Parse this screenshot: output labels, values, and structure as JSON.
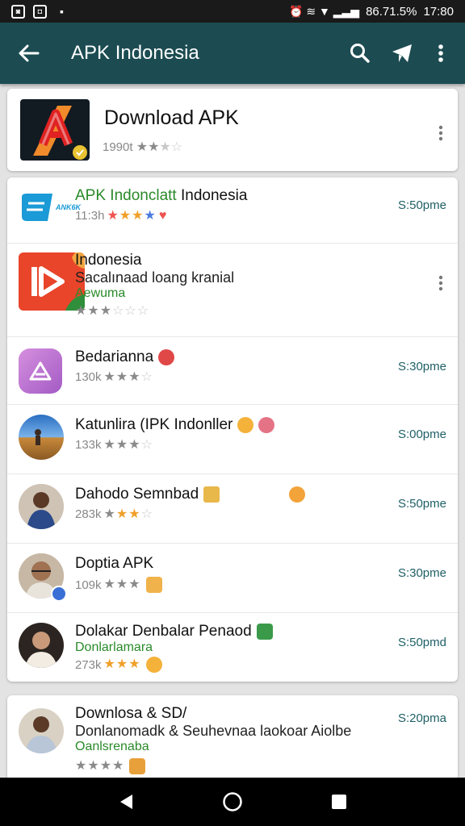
{
  "status_bar": {
    "notifications": [
      "◙",
      "◘",
      "▪"
    ],
    "indicators": "⏰ ≋ ▼ ▂▃▅",
    "battery": "86.71.5%",
    "time": "17:80"
  },
  "toolbar": {
    "title": "APK Indonesia",
    "icons": [
      "back-arrow-icon",
      "search-icon",
      "send-icon",
      "more-vert-icon"
    ]
  },
  "header_app": {
    "title": "Download APK",
    "count": "1990t",
    "rating": 2.5
  },
  "list": [
    {
      "title_green": "APK Indonclatt",
      "title_dark": "Indonesia",
      "count": "11:3h",
      "time": "S:50pme",
      "icon": "apk-logo-icon",
      "icon_text": "ANK6K"
    },
    {
      "title": "Indonesia",
      "subtitle": "Sacalınaad loang kranial",
      "green": "Aewuma",
      "icon": "video-play-icon"
    },
    {
      "title": "Bedarianna",
      "count": "130k",
      "time": "S:30pme",
      "icon": "purple-app-icon"
    },
    {
      "title": "Katunlira (IPK Indonller",
      "count": "133k",
      "time": "S:00pme",
      "icon": "landscape-avatar"
    },
    {
      "title": "Dahodo Semnbad",
      "count": "283k",
      "time": "S:50pme",
      "icon": "person-avatar"
    },
    {
      "title": "Doptia APK",
      "count": "109k",
      "time": "S:30pme",
      "icon": "verified-avatar"
    },
    {
      "title": "Dolakar Denbalar Penaod",
      "green": "Donlarlamara",
      "count": "273k",
      "time": "S:50pmd",
      "icon": "man-avatar"
    }
  ],
  "bottom_item": {
    "title": "Downlosa & SD/",
    "subtitle": "Donlanomadk & Seuhevnaa laokoar Aiolbe",
    "green": "Oanlsrenaba",
    "time": "S:20pma",
    "icon": "woman-avatar"
  },
  "colors": {
    "toolbar": "#1c4c52",
    "accent_time": "#1e5f66",
    "green_text": "#2a8a2a"
  }
}
